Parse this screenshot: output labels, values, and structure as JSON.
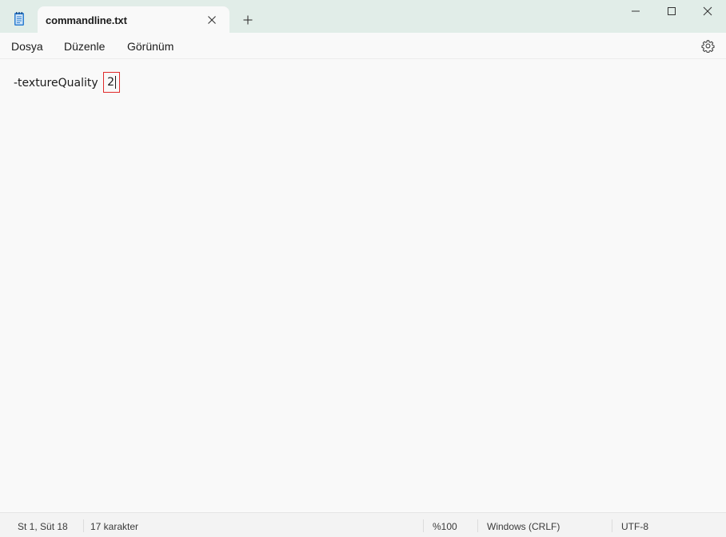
{
  "window": {
    "tab_title": "commandline.txt",
    "accent": "#1e6fd9"
  },
  "menu": {
    "file": "Dosya",
    "edit": "Düzenle",
    "view": "Görünüm"
  },
  "editor": {
    "text_before": "-textureQuality ",
    "highlighted": "2",
    "highlight_color": "#e02a2a"
  },
  "status": {
    "position": "St 1, Süt 18",
    "char_count": "17 karakter",
    "zoom": "%100",
    "line_ending": "Windows (CRLF)",
    "encoding": "UTF-8"
  },
  "icons": {
    "app": "notepad-icon",
    "tab_close": "close-icon",
    "new_tab": "plus-icon",
    "settings": "gear-icon",
    "minimize": "minimize-icon",
    "maximize": "maximize-icon",
    "close": "close-icon"
  }
}
